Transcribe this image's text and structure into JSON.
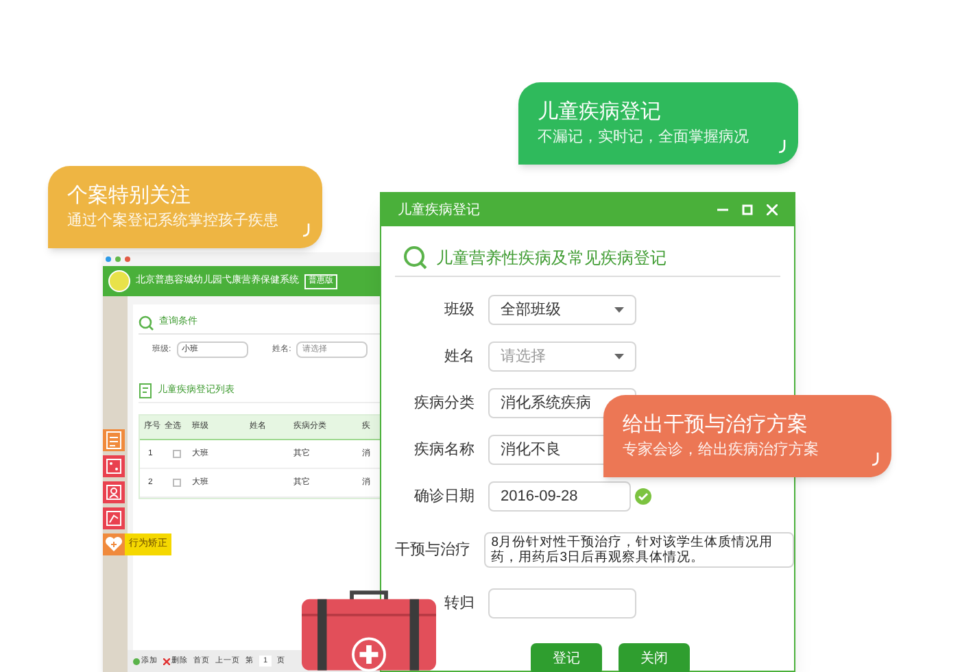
{
  "back_window": {
    "title": "北京普惠容城幼儿园弋康营养保健系统",
    "badge": "普惠版",
    "query": {
      "heading": "查询条件",
      "filters": [
        {
          "label": "班级:",
          "value": "小班"
        },
        {
          "label": "姓名:",
          "placeholder": "请选择"
        }
      ]
    },
    "list": {
      "heading": "儿童疾病登记列表",
      "columns": [
        "序号",
        "全选",
        "班级",
        "姓名",
        "疾病分类",
        "疾"
      ],
      "rows": [
        {
          "cells": [
            "1",
            "",
            "大班",
            "",
            "其它",
            "消"
          ],
          "checked": false
        },
        {
          "cells": [
            "2",
            "",
            "大班",
            "",
            "其它",
            "消"
          ],
          "checked": false
        }
      ]
    },
    "side_menu": [
      {
        "kind": "doc",
        "color": "#f08a3c"
      },
      {
        "kind": "dice",
        "color": "#e9414f"
      },
      {
        "kind": "person",
        "color": "#e9414f"
      },
      {
        "kind": "chart",
        "color": "#e9414f"
      },
      {
        "kind": "heart",
        "color": "#f08a3c",
        "label": "行为矫正"
      }
    ],
    "toolbar": {
      "add": "添加",
      "delete": "删除",
      "first": "首页",
      "prev": "上一页",
      "page_prefix": "第",
      "page": "1",
      "page_suffix": "页"
    }
  },
  "dialog": {
    "title": "儿童疾病登记",
    "heading": "儿童营养性疾病及常见疾病登记",
    "fields": [
      {
        "label": "班级",
        "kind": "select",
        "value": "全部班级"
      },
      {
        "label": "姓名",
        "kind": "select",
        "placeholder": "请选择"
      },
      {
        "label": "疾病分类",
        "kind": "text",
        "value": "消化系统疾病"
      },
      {
        "label": "疾病名称",
        "kind": "text",
        "value": "消化不良"
      },
      {
        "label": "确诊日期",
        "kind": "date",
        "value": "2016-09-28"
      },
      {
        "label": "干预与治疗",
        "kind": "textarea",
        "value": "8月份针对性干预治疗，针对该学生体质情况用药，用药后3日后再观察具体情况。"
      },
      {
        "label": "转归",
        "kind": "text"
      }
    ],
    "buttons": [
      "登记",
      "关闭"
    ]
  },
  "callouts": [
    {
      "title": "个案特别关注",
      "subtitle": "通过个案登记系统掌控孩子疾患",
      "color": "#eeb543"
    },
    {
      "title": "儿童疾病登记",
      "subtitle": "不漏记，实时记，全面掌握病况",
      "color": "#2fba5c"
    },
    {
      "title": "给出干预与治疗方案",
      "subtitle": "专家会诊，给出疾病治疗方案",
      "color": "#ec7755"
    }
  ]
}
